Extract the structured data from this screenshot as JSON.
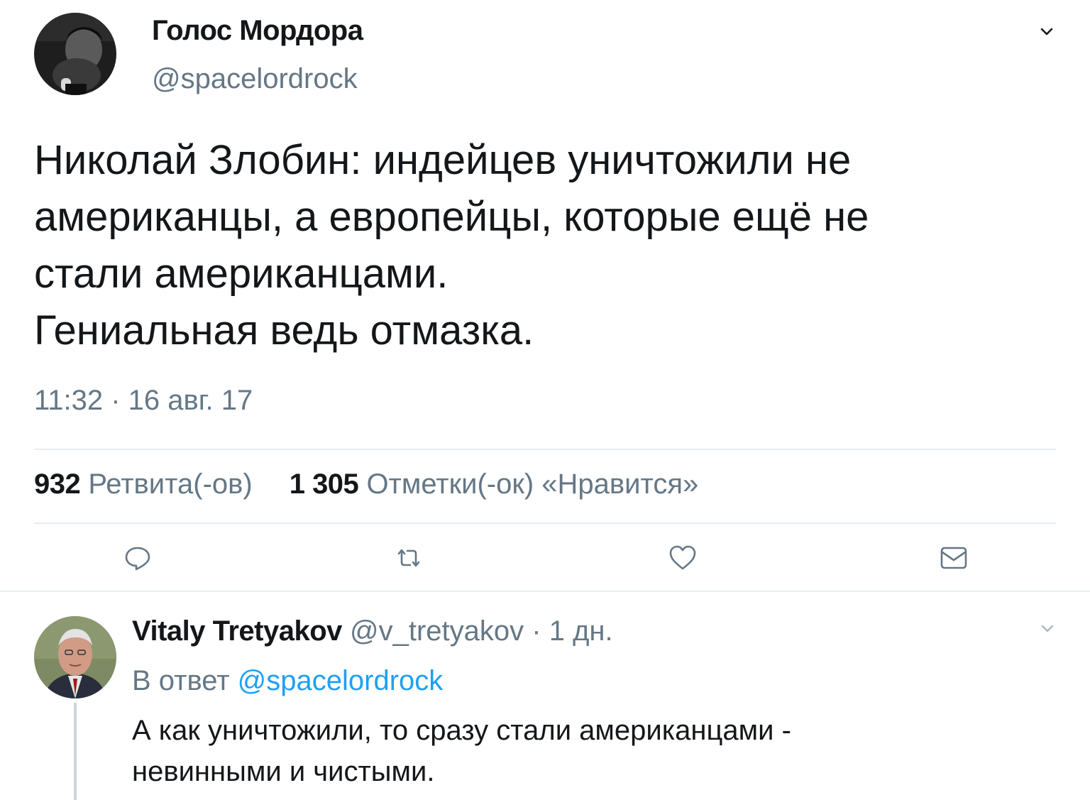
{
  "tweet": {
    "author": {
      "display_name": "Голос Мордора",
      "handle": "@spacelordrock"
    },
    "menu_icon": "chevron-down-icon",
    "text_lines": [
      "Николай Злобин: индейцев уничтожили не",
      "американцы, а европейцы, которые ещё не",
      "стали американцами.",
      "Гениальная ведь отмазка."
    ],
    "timestamp": "11:32 · 16 авг. 17",
    "stats": {
      "retweets_count": "932",
      "retweets_label": "Ретвита(-ов)",
      "likes_count": "1 305",
      "likes_label": "Отметки(-ок) «Нравится»"
    },
    "actions": [
      {
        "icon": "reply-icon"
      },
      {
        "icon": "retweet-icon"
      },
      {
        "icon": "heart-icon"
      },
      {
        "icon": "message-icon"
      }
    ]
  },
  "reply": {
    "author": {
      "display_name": "Vitaly Tretyakov",
      "handle": "@v_tretyakov"
    },
    "separator": " · ",
    "age": "1 дн.",
    "reply_to_label": "В ответ",
    "reply_to_mention": "@spacelordrock",
    "text_lines": [
      "А как уничтожили, то сразу стали американцами -",
      "невинными и чистыми."
    ],
    "menu_icon": "chevron-down-icon"
  },
  "colors": {
    "primary_text": "#14171a",
    "secondary_text": "#657786",
    "link": "#1da1f2",
    "divider": "#e6ecf0"
  }
}
